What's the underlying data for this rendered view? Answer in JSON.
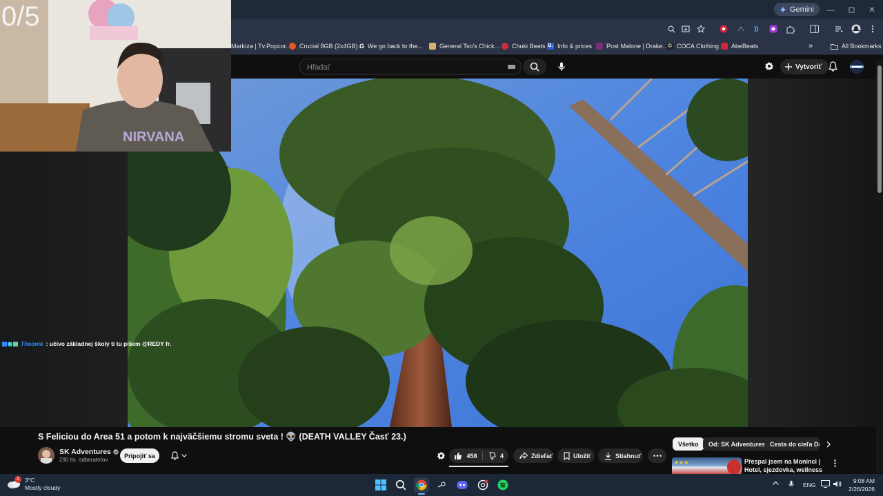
{
  "stream": {
    "counter_text": "0/5",
    "chat": {
      "username": "Theonik",
      "message": ": učivo základnej školy ti tu píšem @REDY fr."
    }
  },
  "browser": {
    "gemini_label": "Gemini",
    "bookmarks": [
      {
        "label": "Markíza | Tv.Popcor...",
        "color": "#2b3447",
        "icon": "none"
      },
      {
        "label": "Crucial 8GB (2x4GB)...",
        "color": "#e85a1f",
        "icon": "crucial-favicon"
      },
      {
        "label": "We go back to the...",
        "color": "#ffffff",
        "icon": "google-favicon",
        "glyph": "G"
      },
      {
        "label": "General Tso's Chick...",
        "color": "#d9b36a",
        "icon": "recipe-favicon"
      },
      {
        "label": "Chuki Beats",
        "color": "#c8323a",
        "icon": "chuki-favicon"
      },
      {
        "label": "Info & prices",
        "color": "#2c5fd6",
        "icon": "b-favicon",
        "glyph": "B."
      },
      {
        "label": "Post Malone | Drake...",
        "color": "#7a2d7a",
        "icon": "post-malone-favicon"
      },
      {
        "label": "COCA Clothing",
        "color": "#222222",
        "icon": "coca-favicon",
        "glyph": "©"
      },
      {
        "label": "AbeBeats",
        "color": "#d3243a",
        "icon": "abebeats-favicon"
      }
    ],
    "all_bookmarks_label": "All Bookmarks"
  },
  "youtube": {
    "search_placeholder": "Hľadať",
    "create_label": "Vytvoriť",
    "video": {
      "title": "S Feliciou do Area 51 a potom k najväčšiemu stromu sveta ! 👽 (DEATH VALLEY Časť 23.)",
      "channel_name": "SK Adventures",
      "subscribers": "290 tis. odberateľov",
      "join_label": "Pripojiť sa",
      "likes": "458",
      "dislikes": "4",
      "share_label": "Zdieľať",
      "save_label": "Uložiť",
      "download_label": "Stiahnuť"
    },
    "chips": [
      "Všetko",
      "Od: SK Adventures",
      "Cesta do cieľa Do"
    ],
    "recommendation": {
      "title": "Přespal jsem na Monínci | Hotel, sjezdovka, wellness"
    }
  },
  "taskbar": {
    "weather_badge": "2",
    "temperature": "3°C",
    "condition": "Mostly cloudy",
    "language": "ENG",
    "time": "9:08 AM",
    "date": "2/26/2026"
  },
  "colors": {
    "accent_blue": "#2f8cff",
    "youtube_bg": "#0f0f0f",
    "taskbar_bg": "#1c2838"
  }
}
